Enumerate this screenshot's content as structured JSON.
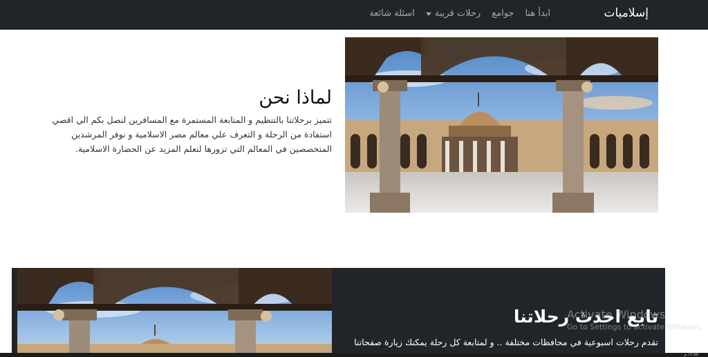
{
  "navbar": {
    "brand": "إسلاميات",
    "links": [
      {
        "label": "ابدأ هنا",
        "has_dropdown": false
      },
      {
        "label": "جوامع",
        "has_dropdown": false
      },
      {
        "label": "رحلات قريبة",
        "has_dropdown": true
      },
      {
        "label": "اسئلة شائعة",
        "has_dropdown": false
      }
    ],
    "bg_color": "#212529"
  },
  "why_us": {
    "title": "لماذا نحن",
    "text": "تتميز برحلاتنا بالتنظيم و المتابعة المستمرة مع المسافرين لنصل بكم الي اقصي استفادة من الرحلة و التعرف علي معالم مصر الاسلامية و نوفر المرشدين المتخصصين في المعالم التي تزورها لتعلم المزيد عن الحضارة الاسلامية."
  },
  "follow": {
    "title": "تابع احدث رحلاتنا",
    "text": "تقدم رحلات اسبوعية في محافظات مختلفة .. و لمتابعة كل رحلة يمكنك زيارة صفحاتنا"
  },
  "watermark": {
    "title": "Activate Windows",
    "subtitle": "Go to Settings to activate Windows."
  },
  "taskbar": {
    "clock": "١٢:٥٥ م"
  }
}
